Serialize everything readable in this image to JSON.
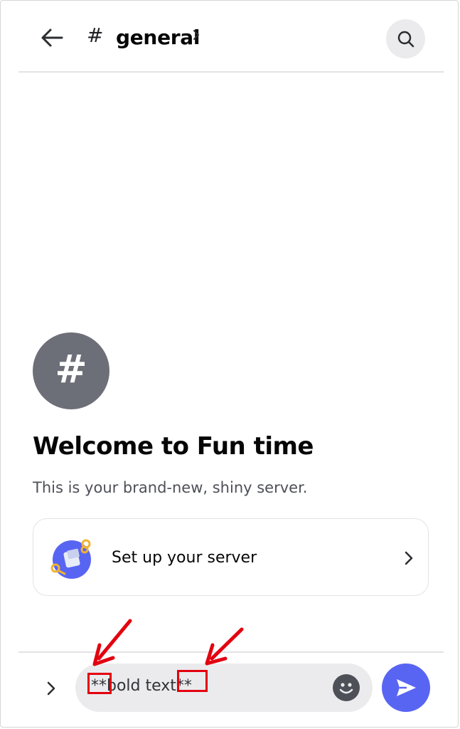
{
  "header": {
    "back_icon": "arrow-left-icon",
    "hash_symbol": "#",
    "channel_name": "general",
    "chevron_icon": "chevron-right-icon",
    "search_icon": "search-icon"
  },
  "welcome": {
    "channel_icon_symbol": "#",
    "title": "Welcome to Fun time",
    "subtitle": "This is your brand-new, shiny server."
  },
  "setup_card": {
    "label": "Set up your server",
    "icon": "server-setup-illustration-icon",
    "chevron_icon": "chevron-right-icon"
  },
  "composer": {
    "expand_icon": "chevron-right-icon",
    "input_value": "**bold text**",
    "emoji_icon": "smiley-face-icon",
    "send_icon": "send-icon"
  },
  "colors": {
    "accent": "#5865f2",
    "annotation": "#e3000f",
    "channel_icon_bg": "#6d6f78"
  }
}
